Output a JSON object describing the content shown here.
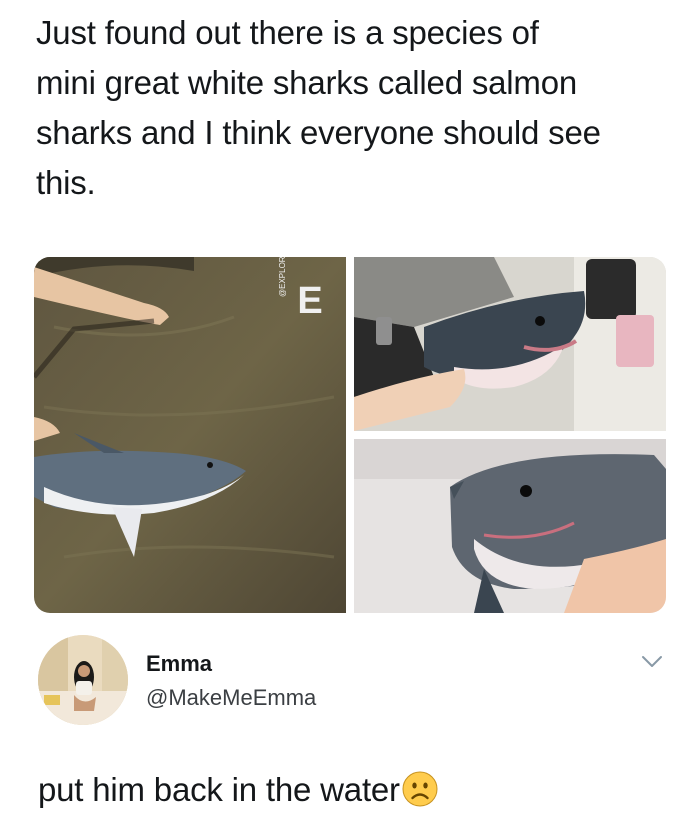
{
  "post": {
    "text": "Just found out there is a species of\nmini great white sharks called salmon\nsharks and I think everyone should see\nthis."
  },
  "media": {
    "watermark_letter": "E",
    "watermark_tag": "@EXPLORIZE"
  },
  "reply": {
    "name": "Emma",
    "handle": "@MakeMeEmma",
    "text": "put him back in the water",
    "emoji_icon": "frowning-face-icon"
  }
}
